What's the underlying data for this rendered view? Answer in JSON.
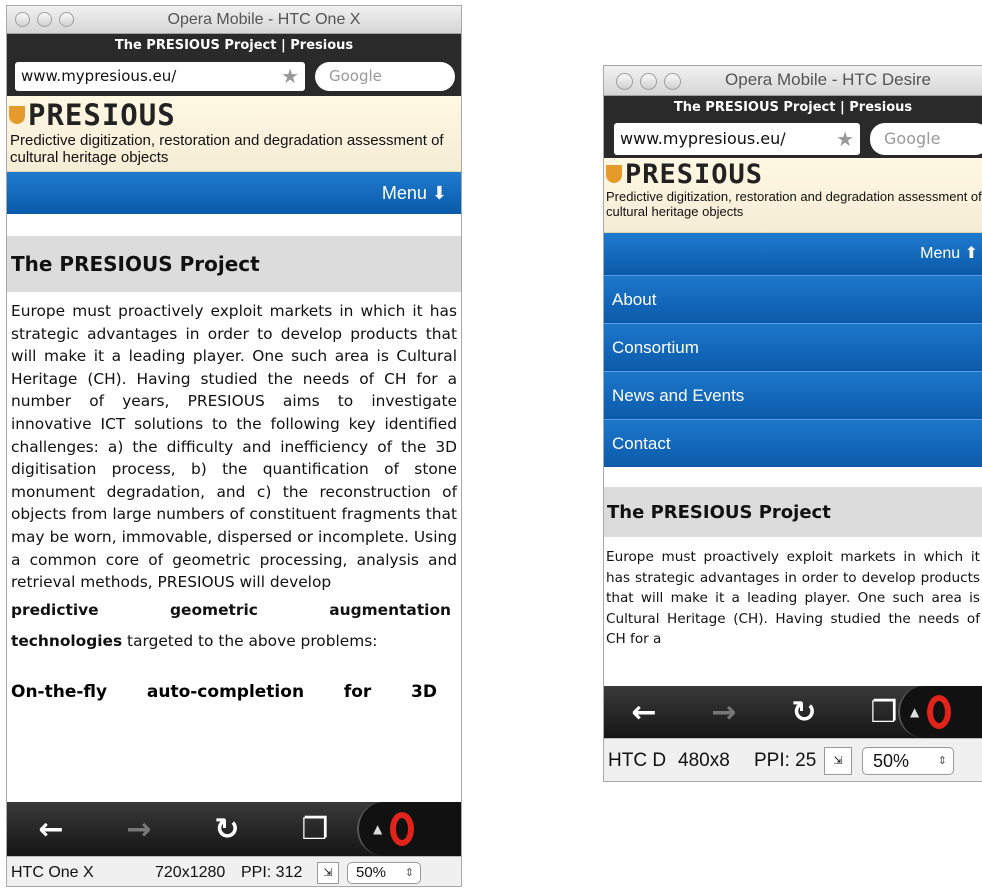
{
  "left": {
    "window_title": "Opera Mobile - HTC One X",
    "page_title": "The PRESIOUS Project | Presious",
    "url": "www.mypresious.eu/",
    "search_placeholder": "Google",
    "logo_text": "PRESIOUS",
    "tagline": "Predictive digitization, restoration and degradation assessment of cultural heritage objects",
    "menu_label": "Menu",
    "section_title": "The PRESIOUS Project",
    "body": "Europe must proactively exploit markets in which it has strategic advantages in order to develop products that will make it a leading player. One such area is Cultural Heritage (CH). Having studied the needs of CH for a number of years, PRESIOUS aims to investigate innovative ICT solutions to the following key identified challenges: a) the difficulty and inefficiency of the 3D digitisation process, b) the quantification of stone monument degradation, and c) the reconstruction of objects from large numbers of constituent fragments that may be worn, immovable, dispersed or incomplete. Using a common core of geometric processing, analysis and retrieval methods, PRESIOUS will develop",
    "bold_words": [
      "predictive",
      "geometric",
      "augmentation"
    ],
    "bold_tail": "technologies",
    "tail": " targeted to the above problems:",
    "subhead_words": [
      "On-the-fly",
      "auto-completion",
      "for",
      "3D"
    ],
    "status_device": "HTC One X",
    "status_res": "720x1280",
    "status_ppi": "PPI: 312",
    "zoom": "50%"
  },
  "right": {
    "window_title": "Opera Mobile - HTC Desire",
    "page_title": "The PRESIOUS Project | Presious",
    "url": "www.mypresious.eu/",
    "search_placeholder": "Google",
    "logo_text": "PRESIOUS",
    "tagline": "Predictive digitization, restoration and degradation assessment of cultural heritage objects",
    "menu_label": "Menu",
    "menu_items": [
      "About",
      "Consortium",
      "News and Events",
      "Contact"
    ],
    "section_title": "The PRESIOUS Project",
    "body": "Europe must proactively exploit markets in which it has strategic advantages in order to develop products that will make it a leading player. One such area is Cultural Heritage (CH). Having studied the needs of CH for a",
    "status_device": "HTC D",
    "status_res": "480x8",
    "status_ppi": "PPI: 25",
    "zoom": "50%"
  },
  "icons": {
    "back": "←",
    "forward": "→",
    "reload": "↻",
    "tabs": "❐",
    "star": "★",
    "menu_down": "⬇",
    "menu_up": "⬆"
  },
  "colors": {
    "menu_blue": "#0a5aa8",
    "opera_red": "#e0241b",
    "header_bg": "#f5ecd6"
  }
}
